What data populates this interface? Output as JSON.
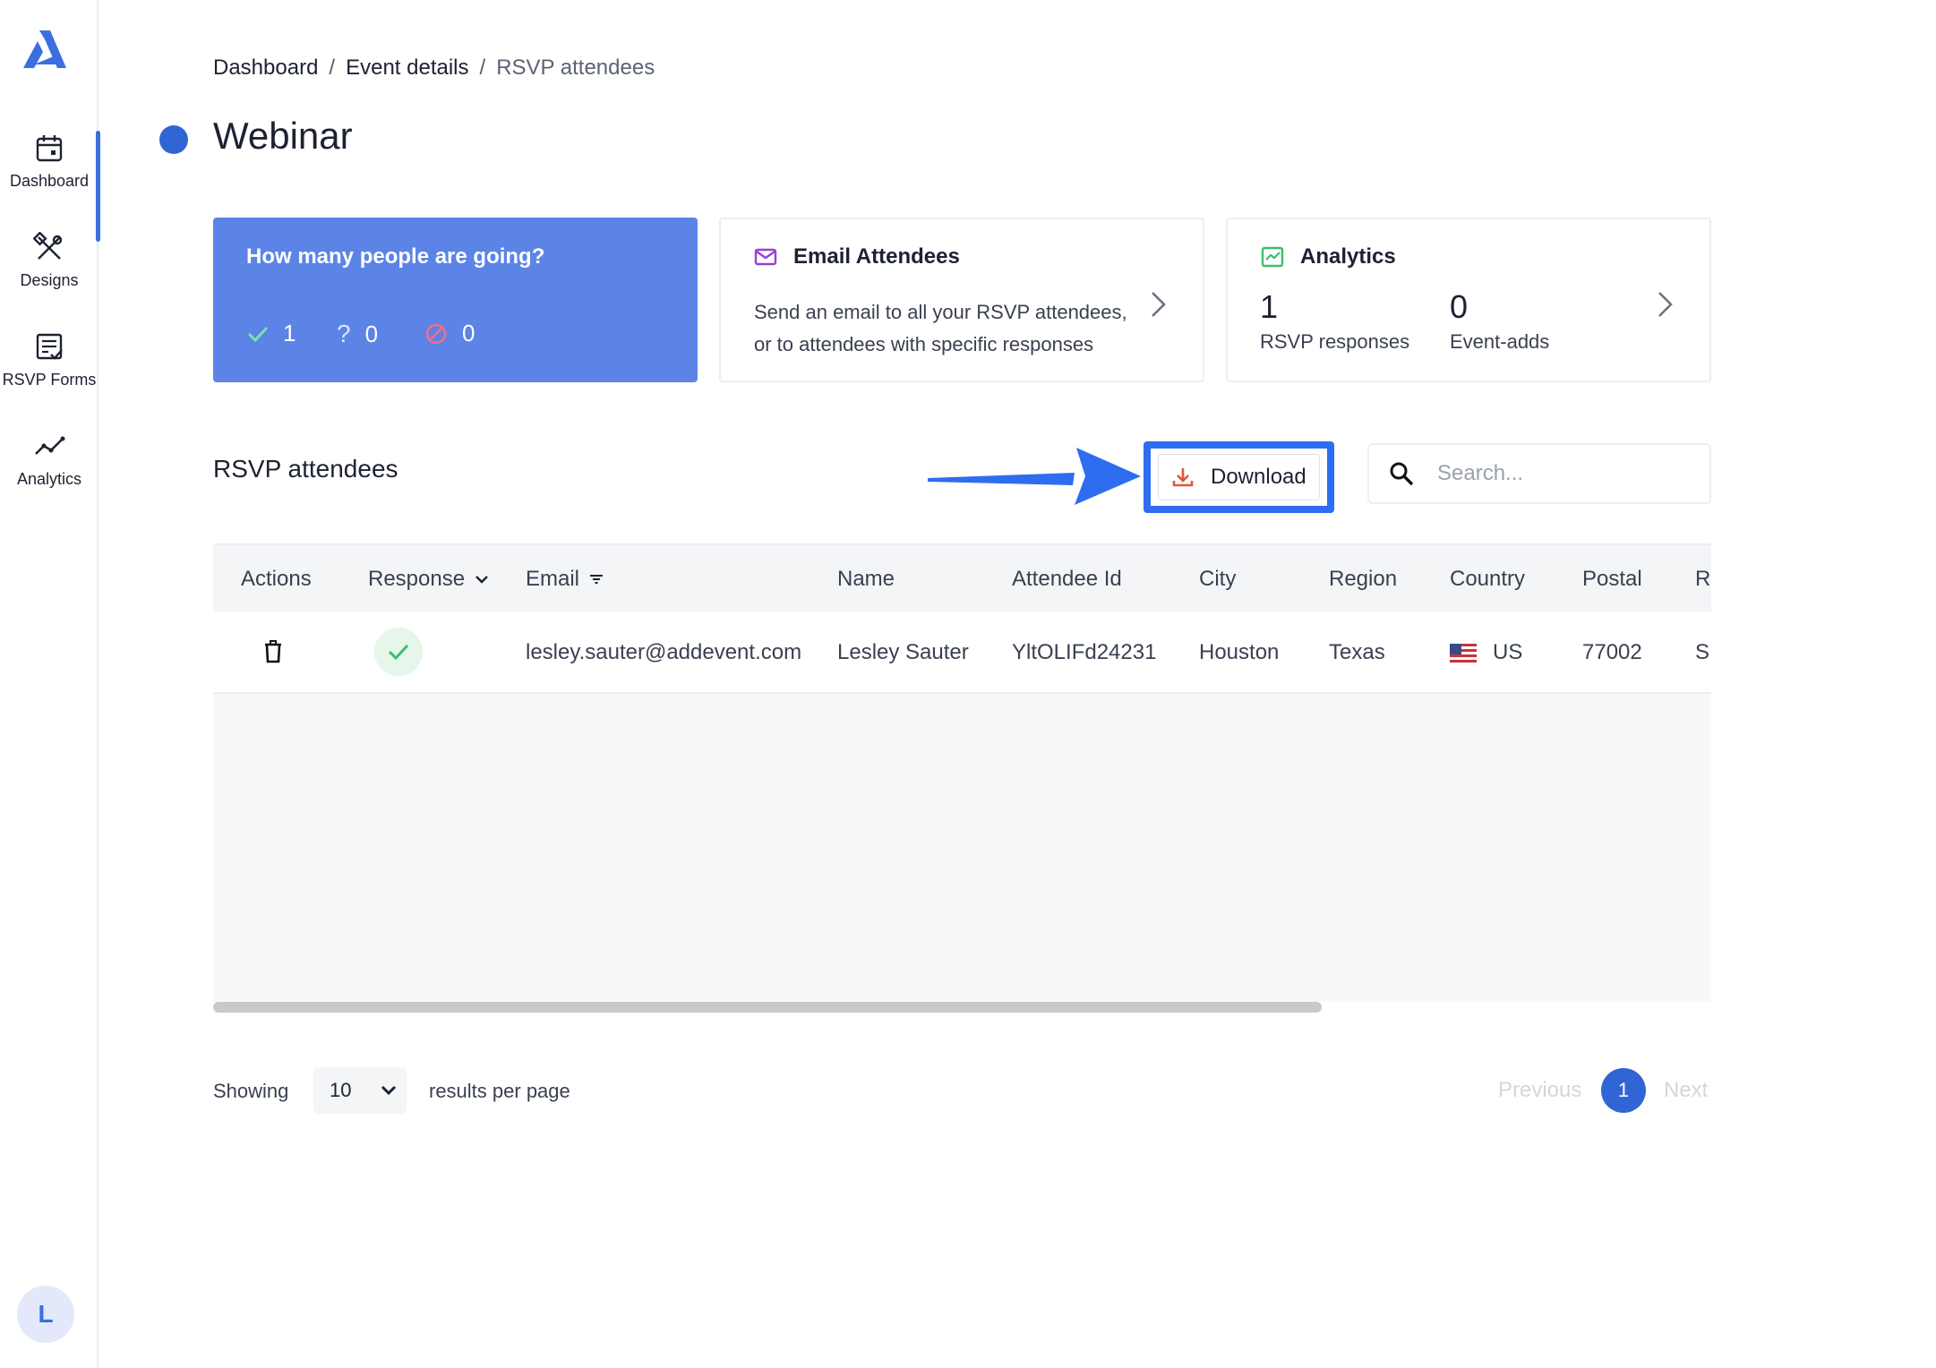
{
  "sidebar": {
    "logo": "addevent-logo",
    "items": [
      {
        "label": "Dashboard",
        "icon": "calendar-icon",
        "active": true
      },
      {
        "label": "Designs",
        "icon": "design-tools-icon"
      },
      {
        "label": "RSVP Forms",
        "icon": "form-checklist-icon"
      },
      {
        "label": "Analytics",
        "icon": "trend-line-icon"
      }
    ],
    "avatar_initial": "L"
  },
  "breadcrumb": {
    "items": [
      "Dashboard",
      "Event details",
      "RSVP attendees"
    ],
    "separator": "/"
  },
  "page": {
    "title": "Webinar",
    "status_color": "#3165d4"
  },
  "cards": {
    "going": {
      "question": "How many people are going?",
      "yes": "1",
      "maybe": "0",
      "no": "0",
      "bg_color": "#5b84e6"
    },
    "email": {
      "title": "Email Attendees",
      "description": "Send an email to all your RSVP attendees, or to attendees with specific responses",
      "icon": "envelope-icon"
    },
    "analytics": {
      "title": "Analytics",
      "icon": "chart-icon",
      "rsvp_count": "1",
      "rsvp_label": "RSVP responses",
      "adds_count": "0",
      "adds_label": "Event-adds"
    }
  },
  "section": {
    "title": "RSVP attendees",
    "download_label": "Download",
    "search_placeholder": "Search...",
    "highlight_color": "#2f6df0"
  },
  "table": {
    "columns": [
      "Actions",
      "Response",
      "Email",
      "Name",
      "Attendee Id",
      "City",
      "Region",
      "Country",
      "Postal",
      "R"
    ],
    "rows": [
      {
        "email": "lesley.sauter@addevent.com",
        "name": "Lesley Sauter",
        "attendee_id": "YltOLIFd24231",
        "city": "Houston",
        "region": "Texas",
        "country": "US",
        "postal": "77002",
        "extra": "S"
      }
    ]
  },
  "pagination": {
    "showing_label": "Showing",
    "per_page": "10",
    "results_label": "results per page",
    "previous": "Previous",
    "current_page": "1",
    "next": "Next"
  }
}
